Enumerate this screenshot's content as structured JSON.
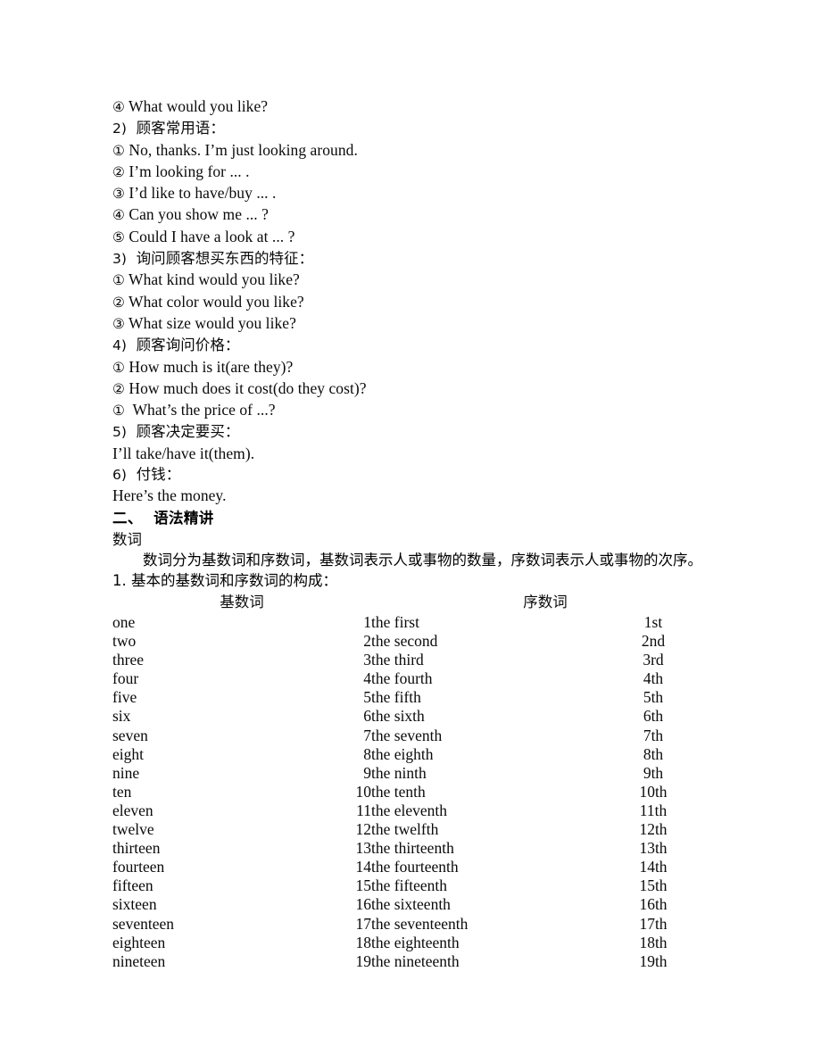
{
  "document": {
    "lines": [
      {
        "id": "line-1",
        "marker": "④",
        "text": " What would you like?",
        "script": "en"
      },
      {
        "id": "line-2",
        "marker": "2)",
        "text": "  顾客常用语：",
        "script": "cn"
      },
      {
        "id": "line-3",
        "marker": "①",
        "text": " No, thanks. I’m just looking around.",
        "script": "en"
      },
      {
        "id": "line-4",
        "marker": "②",
        "text": " I’m looking for ... .",
        "script": "en"
      },
      {
        "id": "line-5",
        "marker": "③",
        "text": " I’d like to have/buy ... .",
        "script": "en"
      },
      {
        "id": "line-6",
        "marker": "④",
        "text": " Can you show me ... ?",
        "script": "en"
      },
      {
        "id": "line-7",
        "marker": "⑤",
        "text": " Could I have a look at ... ?",
        "script": "en"
      },
      {
        "id": "line-8",
        "marker": "3)",
        "text": "  询问顾客想买东西的特征：",
        "script": "cn"
      },
      {
        "id": "line-9",
        "marker": "①",
        "text": " What kind would you like?",
        "script": "en"
      },
      {
        "id": "line-10",
        "marker": "②",
        "text": " What color would you like?",
        "script": "en"
      },
      {
        "id": "line-11",
        "marker": "③",
        "text": " What size would you like?",
        "script": "en"
      },
      {
        "id": "line-12",
        "marker": "4)",
        "text": "  顾客询问价格：",
        "script": "cn"
      },
      {
        "id": "line-13",
        "marker": "①",
        "text": " How much is it(are they)?",
        "script": "en"
      },
      {
        "id": "line-14",
        "marker": "②",
        "text": " How much does it cost(do they cost)?",
        "script": "en"
      },
      {
        "id": "line-15",
        "marker": "①",
        "text": "  What’s the price of ...?",
        "script": "en"
      },
      {
        "id": "line-16",
        "marker": "5)",
        "text": "  顾客决定要买：",
        "script": "cn"
      },
      {
        "id": "line-17",
        "marker": "",
        "text": "I’ll take/have it(them).",
        "script": "en"
      },
      {
        "id": "line-18",
        "marker": "6)",
        "text": "  付钱：",
        "script": "cn"
      },
      {
        "id": "line-19",
        "marker": "",
        "text": "Here’s the money.",
        "script": "en"
      }
    ],
    "section_heading": "二、  语法精讲",
    "subheading": "数词",
    "paragraph": "数词分为基数词和序数词，基数词表示人或事物的数量，序数词表示人或事物的次序。",
    "list_item": "1. 基本的基数词和序数词的构成："
  },
  "table": {
    "headers": {
      "cardinal": "基数词",
      "ordinal": "序数词"
    },
    "rows": [
      {
        "cardinal_word": "one",
        "cardinal_num": "1",
        "ordinal_word": "the first",
        "ordinal_num": "1st",
        "c_indent": 0,
        "o_indent": 1
      },
      {
        "cardinal_word": "two",
        "cardinal_num": "2",
        "ordinal_word": "the second",
        "ordinal_num": "2nd",
        "c_indent": 0,
        "o_indent": 0
      },
      {
        "cardinal_word": "three",
        "cardinal_num": "3",
        "ordinal_word": "the third",
        "ordinal_num": "3rd",
        "c_indent": 1,
        "o_indent": 1
      },
      {
        "cardinal_word": "four",
        "cardinal_num": "4",
        "ordinal_word": "the fourth",
        "ordinal_num": "4th",
        "c_indent": 1,
        "o_indent": 1
      },
      {
        "cardinal_word": "five",
        "cardinal_num": "5",
        "ordinal_word": "the fifth",
        "ordinal_num": "5th",
        "c_indent": 1,
        "o_indent": 2
      },
      {
        "cardinal_word": "six",
        "cardinal_num": "6",
        "ordinal_word": "the sixth",
        "ordinal_num": "6th",
        "c_indent": 0,
        "o_indent": 1
      },
      {
        "cardinal_word": "seven",
        "cardinal_num": "7",
        "ordinal_word": "the seventh",
        "ordinal_num": "7th",
        "c_indent": 1,
        "o_indent": 1
      },
      {
        "cardinal_word": "eight",
        "cardinal_num": "8",
        "ordinal_word": "the eighth",
        "ordinal_num": "8th",
        "c_indent": 1,
        "o_indent": 1
      },
      {
        "cardinal_word": "nine",
        "cardinal_num": "9",
        "ordinal_word": "the ninth",
        "ordinal_num": "9th",
        "c_indent": 1,
        "o_indent": 1
      },
      {
        "cardinal_word": "ten",
        "cardinal_num": "10",
        "ordinal_word": "the tenth",
        "ordinal_num": "10th",
        "c_indent": 0,
        "o_indent": 0
      },
      {
        "cardinal_word": "eleven",
        "cardinal_num": "11",
        "ordinal_word": "the eleventh",
        "ordinal_num": "11th",
        "c_indent": 0,
        "o_indent": 0
      },
      {
        "cardinal_word": "twelve",
        "cardinal_num": "12",
        "ordinal_word": "the twelfth",
        "ordinal_num": "12th",
        "c_indent": 0,
        "o_indent": 0
      },
      {
        "cardinal_word": "thirteen",
        "cardinal_num": "13",
        "ordinal_word": "the thirteenth",
        "ordinal_num": "13th",
        "c_indent": 1,
        "o_indent": 1
      },
      {
        "cardinal_word": "fourteen",
        "cardinal_num": "14",
        "ordinal_word": "the fourteenth",
        "ordinal_num": "14th",
        "c_indent": 1,
        "o_indent": 1
      },
      {
        "cardinal_word": "fifteen",
        "cardinal_num": "15",
        "ordinal_word": "the fifteenth",
        "ordinal_num": "15th",
        "c_indent": 1,
        "o_indent": 2
      },
      {
        "cardinal_word": "sixteen",
        "cardinal_num": "16",
        "ordinal_word": "the sixteenth",
        "ordinal_num": "16th",
        "c_indent": 1,
        "o_indent": 1
      },
      {
        "cardinal_word": "seventeen",
        "cardinal_num": "17",
        "ordinal_word": "the seventeenth",
        "ordinal_num": "17th",
        "c_indent": 0,
        "o_indent": 1
      },
      {
        "cardinal_word": "eighteen",
        "cardinal_num": "18",
        "ordinal_word": "the eighteenth",
        "ordinal_num": "18th",
        "c_indent": 1,
        "o_indent": 1
      },
      {
        "cardinal_word": "nineteen",
        "cardinal_num": "19",
        "ordinal_word": "the nineteenth",
        "ordinal_num": "19th",
        "c_indent": 1,
        "o_indent": 1
      }
    ]
  },
  "colors": {
    "page_background": "#ffffff",
    "text": "#0a0a0a"
  }
}
